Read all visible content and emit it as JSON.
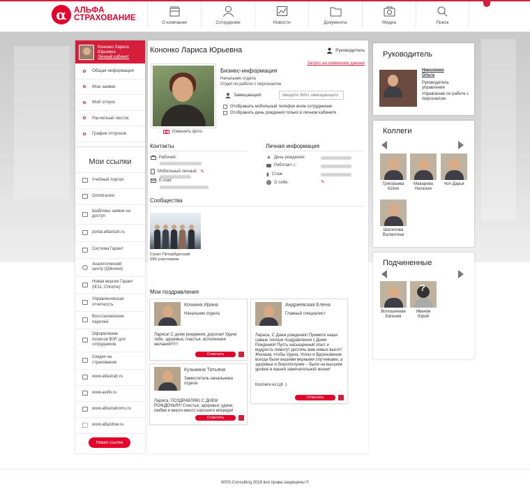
{
  "header": {
    "logo_mark": "α",
    "logo_line1": "АЛЬФА",
    "logo_line2": "СТРАХОВАНИЕ",
    "nav": [
      {
        "label": "О компании",
        "icon": "building-icon"
      },
      {
        "label": "Сотрудники",
        "icon": "person-icon"
      },
      {
        "label": "Новости",
        "icon": "news-icon"
      },
      {
        "label": "Документы",
        "icon": "folder-icon"
      },
      {
        "label": "Медиа",
        "icon": "camera-icon"
      },
      {
        "label": "Поиск",
        "icon": "search-icon"
      }
    ]
  },
  "sidebar": {
    "user_name_line1": "Кононко Лариса",
    "user_name_line2": "Юрьевна",
    "cabinet_link": "Личный кабинет",
    "menu": [
      "Общая информация",
      "Мои заявки",
      "Мой отпуск",
      "Расчетный листок",
      "График отпусков"
    ],
    "links_title": "Мои ссылки",
    "links": [
      {
        "label": "Учебный портал",
        "icon": "monitor-icon"
      },
      {
        "label": "Omnitracker",
        "icon": "monitor-icon"
      },
      {
        "label": "Шаблоны заявок на доступ",
        "icon": "monitor-icon"
      },
      {
        "label": "portal.alfastrah.ru",
        "icon": "monitor-icon"
      },
      {
        "label": "Система Гарант",
        "icon": "monitor-icon"
      },
      {
        "label": "Аналитический центр (Qlikview)",
        "icon": "qlik-icon"
      },
      {
        "label": "Новая версия Гарант (IE11, Chrome)",
        "icon": "monitor-icon"
      },
      {
        "label": "Управленческая отчетность",
        "icon": "monitor-icon"
      },
      {
        "label": "Восстановление паролей",
        "icon": "monitor-icon"
      },
      {
        "label": "Оформление полисов ВЗР для сотрудников",
        "icon": "monitor-icon"
      },
      {
        "label": "Скидки на страхование",
        "icon": "monitor-icon"
      },
      {
        "label": "www.alfastrah.ru",
        "icon": "monitor-icon"
      },
      {
        "label": "www.aslife.ru",
        "icon": "monitor-icon"
      },
      {
        "label": "www.alfastrahoms.ru",
        "icon": "monitor-icon"
      },
      {
        "label": "www.alfazdrav.ru",
        "icon": "network-icon"
      }
    ],
    "new_link_button": "Новая ссылка"
  },
  "profile": {
    "name": "Кононко Лариса Юрьевна",
    "role_tag": "Руководитель",
    "request_link": "Запрос на изменение данных",
    "change_photo": "Изменить фото",
    "business_title": "Бизнес-информация",
    "position": "Начальник отдела",
    "department": "Отдел по работе с персоналом",
    "deputy_label": "Замещающий:",
    "deputy_placeholder": "Введите ФИО замещающего",
    "checkbox_mobile": "Отображать мобильный телефон всем сотрудникам",
    "checkbox_birthday": "Отображать день рождения только в личном кабинете",
    "contacts_title": "Контакты",
    "contact_work": "Рабочий:",
    "contact_mobile": "Мобильный личный:",
    "contact_email": "E-mail:",
    "personal_title": "Личная информация",
    "personal_birthday": "День рождения:",
    "personal_works_since": "Работает с:",
    "personal_experience": "Стаж:",
    "personal_about": "О себе:",
    "communities_title": "Сообщества",
    "community_name": "Санкт-Петербургский",
    "community_members": "296 участников",
    "greetings_title": "Мои поздравления"
  },
  "greetings": [
    {
      "name": "Кочкина Ирина",
      "role": "Начальник отдела",
      "text": "Лариса! С днем рождения, дорогая! Удачи тебе, здоровья, счастья, исполнения желаний!!!!!!",
      "reply": "Ответить"
    },
    {
      "name": "Андриевская Елена",
      "role": "Главный специалист",
      "text": "Лариса, С Днем рождения! Примите наши самые теплые поздравления с Днем Рождения! Пусть насыщенный опыт и мудрость помогут достичь вам новых высот! Желаем, чтобы Удача, Успех и Вдохновение всегда были вашими верными спутниками, а здоровье и благополучие – были на высшем уровне в вашей замечательной жизни!",
      "signature": "Коллеги из ЦК :)",
      "reply": "Ответить"
    },
    {
      "name": "Кузьмина Татьяна",
      "role": "Заместитель начальника отдела",
      "text": "Лариса, ПОЗДРАВЛЯЮ С ДНЕМ РОЖДЕНЬЯ!!! Счастья, здоровья, удачи, любви и много-много хорошего впереди!",
      "reply": "Ответить"
    }
  ],
  "manager": {
    "title": "Руководитель",
    "name_line1": "Николенко",
    "name_line2": "Ольга",
    "role": "Руководитель управления",
    "department": "Управление по работе с персоналом"
  },
  "colleagues": {
    "title": "Коллеги",
    "people": [
      {
        "line1": "Григорьева",
        "line2": "Юлия"
      },
      {
        "line1": "Макарова",
        "line2": "Наталия"
      },
      {
        "line1": "Чоп Дарья",
        "line2": ""
      },
      {
        "line1": "Шатилова",
        "line2": "Валентина"
      }
    ]
  },
  "subordinates": {
    "title": "Подчиненные",
    "people": [
      {
        "line1": "Волошинова",
        "line2": "Евгения"
      },
      {
        "line1": "Иванов",
        "line2": "Юрий"
      }
    ]
  },
  "footer": "WSS-Consulting 2018 все права защищены ©",
  "colors": {
    "accent": "#e3002b",
    "brand_red": "#d51f3a"
  }
}
